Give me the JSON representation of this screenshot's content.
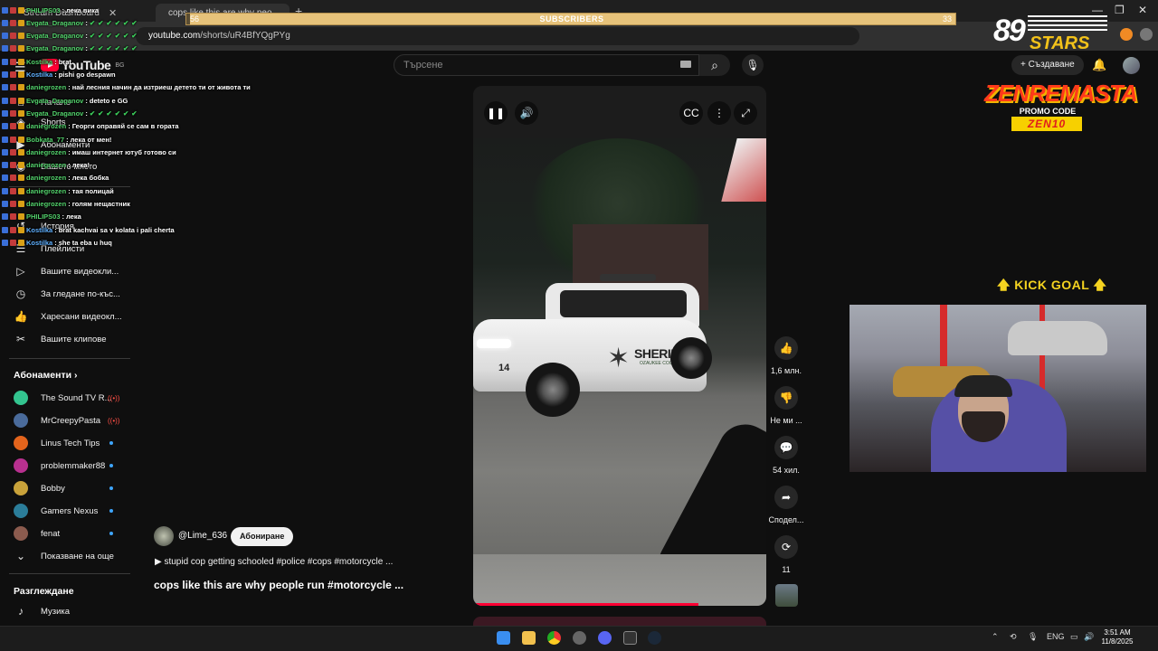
{
  "browser": {
    "tabs": [
      {
        "label": "Stream Dashboard",
        "active": false
      },
      {
        "label": "cops like this are why peo...",
        "active": true
      }
    ],
    "url_host": "youtube.com",
    "url_path": "/shorts/uR4BfYQgPYg",
    "win_controls": [
      "—",
      "❐",
      "✕"
    ]
  },
  "youtube": {
    "logo_text": "YouTube",
    "logo_region": "BG",
    "search_placeholder": "Търсене",
    "create_label": "Създаване"
  },
  "sidebar": {
    "main": [
      {
        "label": "Начало",
        "icon": "home-icon"
      },
      {
        "label": "Shorts",
        "icon": "shorts-icon"
      },
      {
        "label": "Абонаменти",
        "icon": "subscriptions-icon"
      },
      {
        "label": "Вашето място",
        "icon": "you-icon"
      }
    ],
    "you": [
      {
        "label": "История",
        "icon": "history-icon"
      },
      {
        "label": "Плейлисти",
        "icon": "playlists-icon"
      },
      {
        "label": "Вашите видеокли...",
        "icon": "your-videos-icon"
      },
      {
        "label": "За гледане по-къс...",
        "icon": "watch-later-icon"
      },
      {
        "label": "Харесани видеокл...",
        "icon": "liked-icon"
      },
      {
        "label": "Вашите клипове",
        "icon": "clips-icon"
      }
    ],
    "subs_heading": "Абонаменти",
    "subscriptions": [
      {
        "name": "The Sound TV R...",
        "status": "live",
        "color": "#33c48f"
      },
      {
        "name": "MrCreepyPasta",
        "status": "live",
        "color": "#4a6b9b"
      },
      {
        "name": "Linus Tech Tips",
        "status": "dot",
        "color": "#e3641c"
      },
      {
        "name": "problemmaker88",
        "status": "dot",
        "color": "#b8308f"
      },
      {
        "name": "Bobby",
        "status": "dot",
        "color": "#c9a23a"
      },
      {
        "name": "Gamers Nexus",
        "status": "dot",
        "color": "#2b7d99"
      },
      {
        "name": "fenat",
        "status": "dot",
        "color": "#8b5b4e"
      }
    ],
    "show_more": "Показване на още",
    "explore_heading": "Разглеждане",
    "explore": [
      {
        "label": "Музика",
        "icon": "music-icon"
      }
    ]
  },
  "short": {
    "channel": "@Lime_636",
    "subscribe_label": "Абониране",
    "description": "▶ stupid cop getting schooled #police #cops #motorcycle ...",
    "title": "cops like this are why people run #motorcycle ...",
    "car_text": "SHERIFF",
    "car_subtext": "OZAUKEE COUNTY",
    "car_number": "14",
    "progress": 0.77,
    "actions": [
      {
        "name": "like",
        "label": "1,6 млн.",
        "icon": "👍"
      },
      {
        "name": "dislike",
        "label": "Не ми ...",
        "icon": "👎"
      },
      {
        "name": "comments",
        "label": "54 хил.",
        "icon": "💬"
      },
      {
        "name": "share",
        "label": "Сподел...",
        "icon": "➦"
      },
      {
        "name": "remix",
        "label": "11",
        "icon": "⟳"
      }
    ]
  },
  "overlay": {
    "sub_goal_label": "SUBSCRIBERS",
    "sub_goal_current": "56",
    "sub_goal_target": "33",
    "sub_goal_progress": 0.005,
    "chat": [
      {
        "user": "PHILIPS03",
        "msg": "лека вика",
        "color": "green"
      },
      {
        "user": "Evgata_Draganov",
        "msg": "✔✔✔✔✔✔",
        "color": "green",
        "emote": true
      },
      {
        "user": "Evgata_Draganov",
        "msg": "✔✔✔✔✔✔",
        "color": "green",
        "emote": true
      },
      {
        "user": "Evgata_Draganov",
        "msg": "✔✔✔✔✔✔",
        "color": "green",
        "emote": true
      },
      {
        "user": "Kostilka",
        "msg": "brat",
        "color": "green"
      },
      {
        "user": "Kostilka",
        "msg": "pishi go despawn",
        "color": "blue"
      },
      {
        "user": "daniegrozen",
        "msg": "най лесния начин да изтриеш детето ти от живота ти",
        "color": "green"
      },
      {
        "user": "Evgata_Draganov",
        "msg": "deteto e GG",
        "color": "green"
      },
      {
        "user": "Evgata_Draganov",
        "msg": "✔✔✔✔✔✔",
        "color": "green",
        "emote": true
      },
      {
        "user": "daniegrozen",
        "msg": "Георги оправяй се сам в гората",
        "color": "green"
      },
      {
        "user": "Bobkata_77",
        "msg": "лека от мен!",
        "color": "green"
      },
      {
        "user": "daniegrozen",
        "msg": "имаш интернет ютуб готово си",
        "color": "green"
      },
      {
        "user": "daniegrozen",
        "msg": "лека!",
        "color": "green"
      },
      {
        "user": "daniegrozen",
        "msg": "лека бобка",
        "color": "green"
      },
      {
        "user": "daniegrozen",
        "msg": "тая полицай",
        "color": "green"
      },
      {
        "user": "daniegrozen",
        "msg": "голям нещастник",
        "color": "green"
      },
      {
        "user": "PHILIPS03",
        "msg": "лека",
        "color": "green"
      },
      {
        "user": "Kostilka",
        "msg": "brat kachvai sa v kolata i pali cherta",
        "color": "blue"
      },
      {
        "user": "Kostilka",
        "msg": "she ta eba u huq",
        "color": "blue"
      }
    ],
    "logo_num": "89",
    "logo_word": "STARS",
    "sponsor_name": "ZENREMASTA",
    "sponsor_promo": "PROMO CODE",
    "sponsor_code": "ZEN10",
    "kick_goal": "🡅 KICK GOAL 🡅"
  },
  "taskbar": {
    "lang": "ENG",
    "time": "3:51 AM",
    "date": "11/8/2025",
    "tray_arrow": "⌃"
  }
}
